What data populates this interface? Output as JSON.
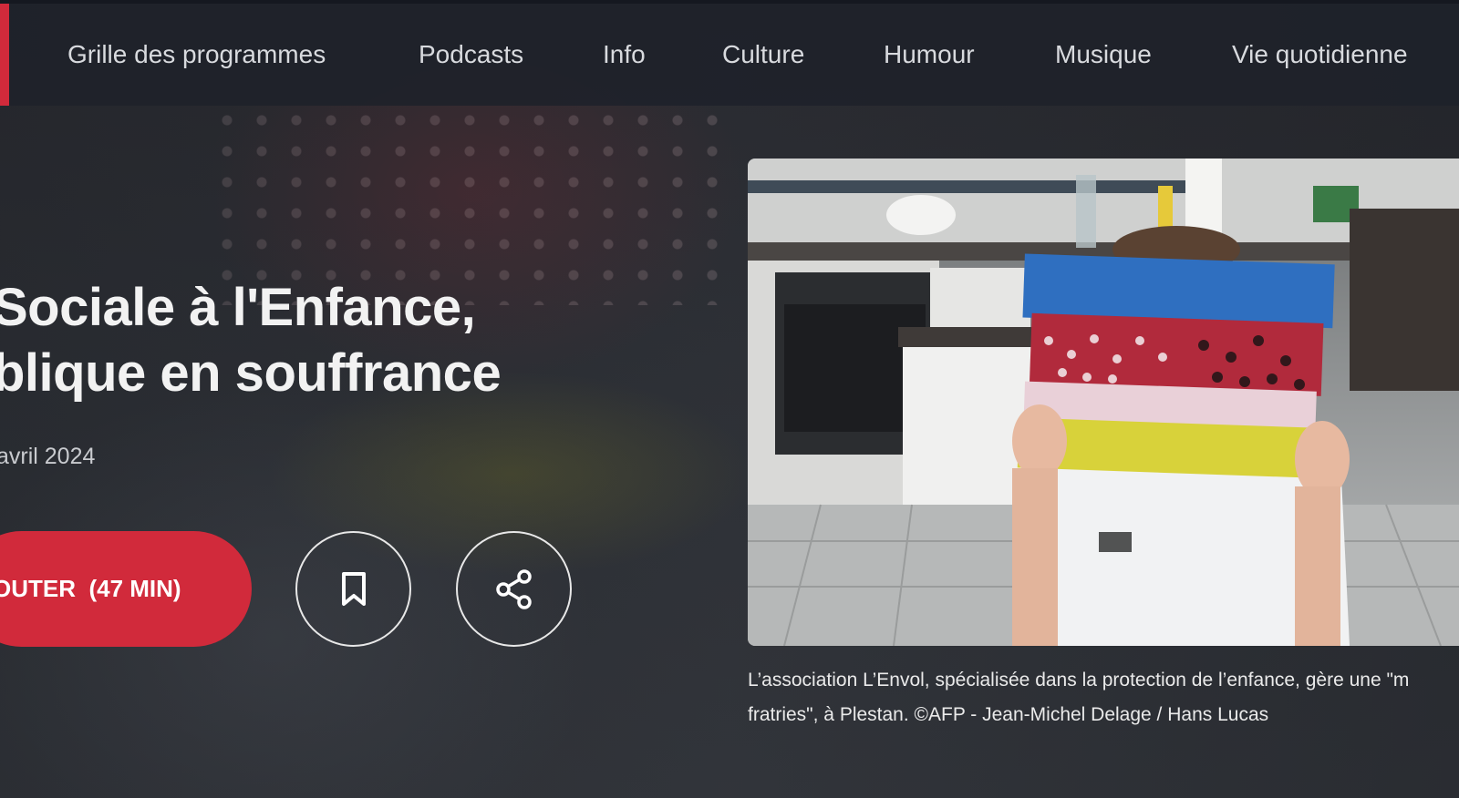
{
  "nav": {
    "items": [
      {
        "label": "Grille des programmes"
      },
      {
        "label": "Podcasts"
      },
      {
        "label": "Info"
      },
      {
        "label": "Culture"
      },
      {
        "label": "Humour"
      },
      {
        "label": "Musique"
      },
      {
        "label": "Vie quotidienne"
      }
    ]
  },
  "episode": {
    "title_line1": "Sociale à l'Enfance,",
    "title_line2": "blique en souffrance",
    "date": "avril 2024",
    "listen_label": "OUTER  (47 MIN)"
  },
  "icons": {
    "bookmark": "bookmark-icon",
    "share": "share-icon"
  },
  "image": {
    "caption_line1": "L’association L’Envol, spécialisée dans la protection de l’enfance, gère une \"m",
    "caption_line2": "fratries\", à Plestan. ©AFP - Jean-Michel Delage / Hans Lucas"
  },
  "colors": {
    "accent": "#d12a3b",
    "nav_bg": "#1e222a",
    "text": "#f2f2f2"
  }
}
